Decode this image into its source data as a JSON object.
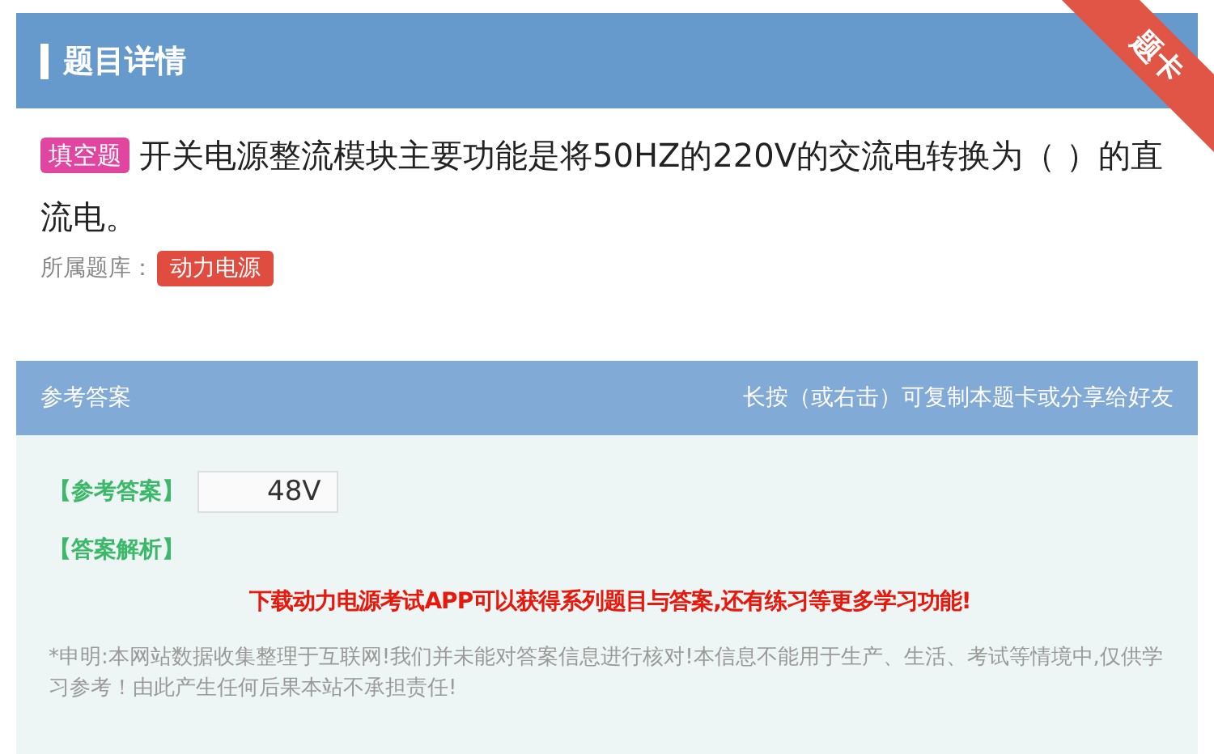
{
  "header": {
    "title": "题目详情",
    "ribbon": "题卡"
  },
  "question": {
    "type_badge": "填空题",
    "text": "开关电源整流模块主要功能是将50HZ的220V的交流电转换为（ ）的直流电。",
    "bank_label": "所属题库：",
    "bank_tag": "动力电源"
  },
  "answer_section": {
    "title": "参考答案",
    "hint": "长按（或右击）可复制本题卡或分享给好友",
    "answer_label": "【参考答案】",
    "answer_value": "48V",
    "analysis_label": "【答案解析】",
    "promo": "下载动力电源考试APP可以获得系列题目与答案,还有练习等更多学习功能!",
    "disclaimer": "*申明:本网站数据收集整理于互联网!我们并未能对答案信息进行核对!本信息不能用于生产、生活、考试等情境中,仅供学习参考！由此产生任何后果本站不承担责任!"
  }
}
